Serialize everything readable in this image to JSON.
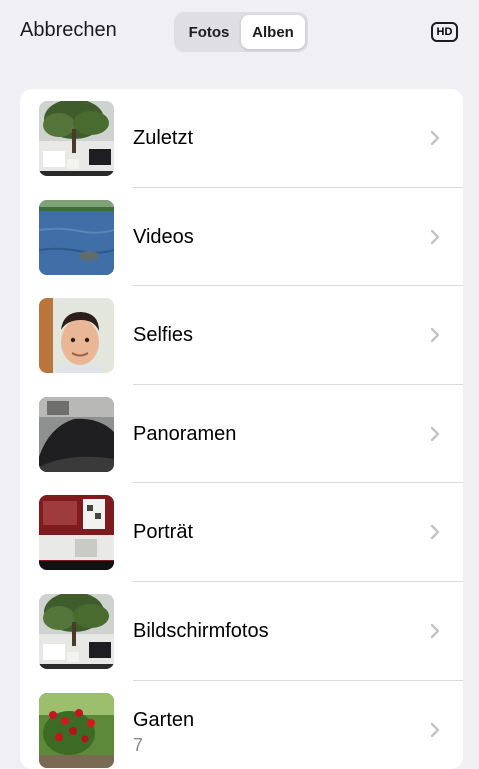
{
  "header": {
    "cancel_label": "Abbrechen",
    "tabs": [
      {
        "label": "Fotos",
        "active": false
      },
      {
        "label": "Alben",
        "active": true
      }
    ],
    "hd_label": "HD"
  },
  "albums": [
    {
      "name": "Zuletzt",
      "thumbnail": "plant-desk-photo"
    },
    {
      "name": "Videos",
      "thumbnail": "lake-water-photo"
    },
    {
      "name": "Selfies",
      "thumbnail": "selfie-face-photo"
    },
    {
      "name": "Panoramen",
      "thumbnail": "dark-mound-photo"
    },
    {
      "name": "Porträt",
      "thumbnail": "red-document-screen-photo"
    },
    {
      "name": "Bildschirmfotos",
      "thumbnail": "plant-desk-photo"
    },
    {
      "name": "Garten",
      "count": "7",
      "thumbnail": "red-roses-garden-photo"
    }
  ],
  "colors": {
    "background": "#efeff4",
    "card": "#ffffff",
    "chevron": "#c4c4c7",
    "secondary_text": "#8a8a8e"
  }
}
